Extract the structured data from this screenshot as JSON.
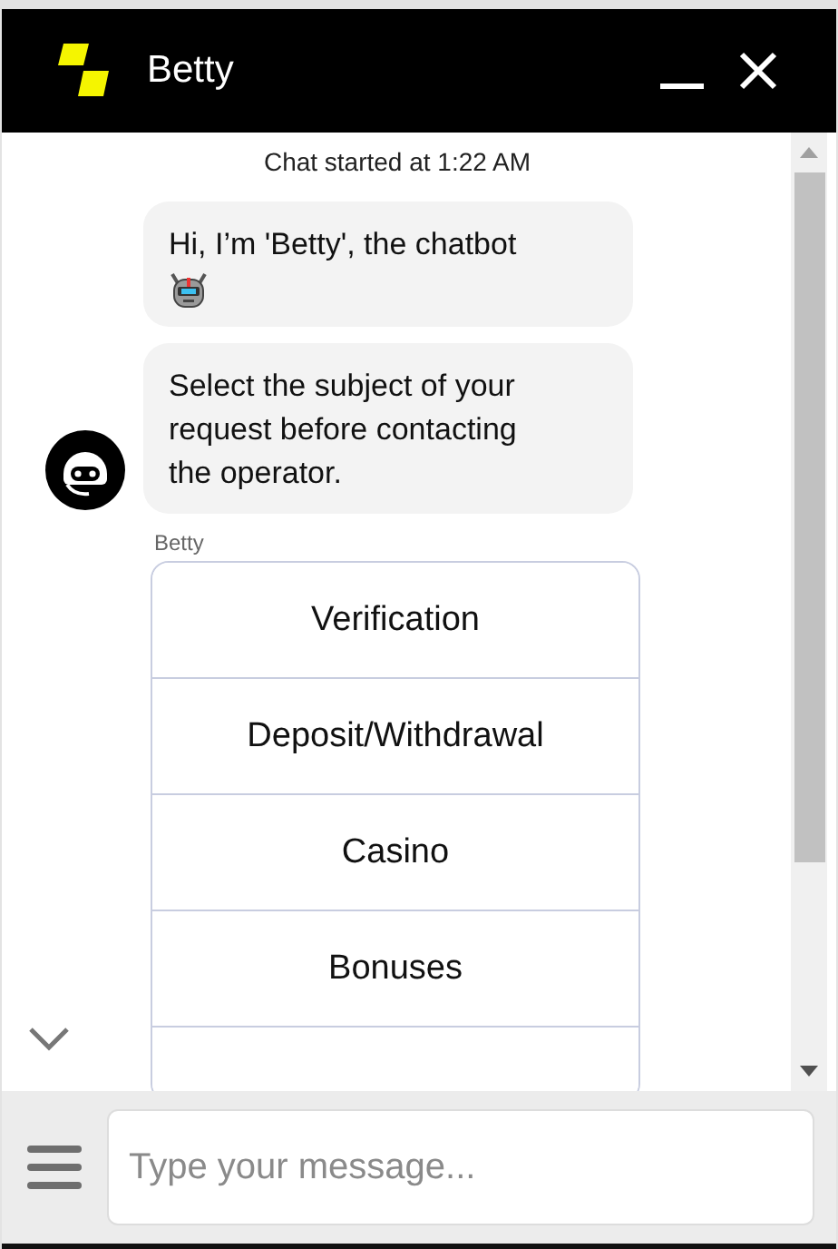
{
  "window": {
    "title": "Betty"
  },
  "chat": {
    "started": "Chat started at 1:22 AM",
    "messages": [
      {
        "text": "Hi, I’m 'Betty', the chatbot",
        "kind": "with-emoji",
        "avatar": false
      },
      {
        "text": "Select the subject of your request before contacting the operator.",
        "kind": "plain",
        "avatar": true
      }
    ],
    "sender": "Betty",
    "options": [
      "Verification",
      "Deposit/Withdrawal",
      "Casino",
      "Bonuses"
    ]
  },
  "composer": {
    "placeholder": "Type your message..."
  }
}
